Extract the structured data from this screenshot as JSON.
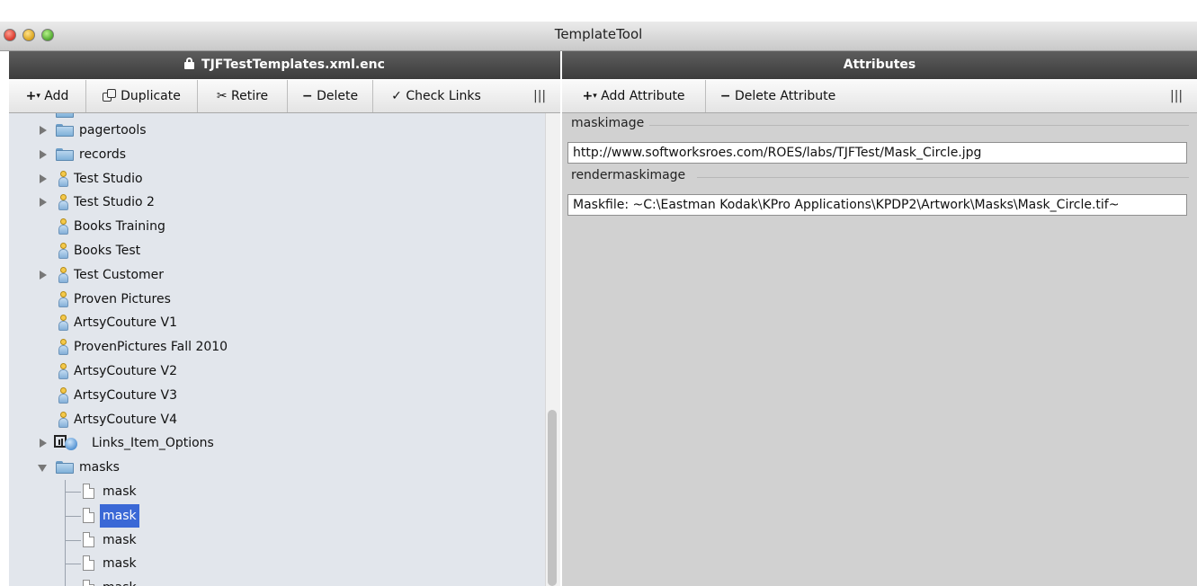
{
  "window": {
    "title": "TemplateTool"
  },
  "left_panel": {
    "header": "TJFTestTemplates.xml.enc",
    "toolbar": {
      "add": "Add",
      "duplicate": "Duplicate",
      "retire": "Retire",
      "delete": "Delete",
      "check_links": "Check Links"
    },
    "tree": [
      {
        "label": "pagertools",
        "icon": "folder-icon",
        "expander": "collapsed"
      },
      {
        "label": "records",
        "icon": "folder-icon",
        "expander": "collapsed"
      },
      {
        "label": "Test Studio",
        "icon": "user-icon",
        "expander": "collapsed"
      },
      {
        "label": "Test Studio 2",
        "icon": "user-icon",
        "expander": "collapsed"
      },
      {
        "label": "Books Training",
        "icon": "user-icon",
        "expander": "none"
      },
      {
        "label": "Books Test",
        "icon": "user-icon",
        "expander": "none"
      },
      {
        "label": "Test Customer",
        "icon": "user-icon",
        "expander": "collapsed"
      },
      {
        "label": "Proven Pictures",
        "icon": "user-icon",
        "expander": "none"
      },
      {
        "label": "ArtsyCouture V1",
        "icon": "user-icon",
        "expander": "none"
      },
      {
        "label": "ProvenPictures Fall 2010",
        "icon": "user-icon",
        "expander": "none"
      },
      {
        "label": "ArtsyCouture V2",
        "icon": "user-icon",
        "expander": "none"
      },
      {
        "label": "ArtsyCouture V3",
        "icon": "user-icon",
        "expander": "none"
      },
      {
        "label": "ArtsyCouture V4",
        "icon": "user-icon",
        "expander": "none"
      },
      {
        "label": "Links_Item_Options",
        "icon": "links-icon",
        "expander": "collapsed"
      },
      {
        "label": "masks",
        "icon": "folder-icon",
        "expander": "expanded"
      },
      {
        "label": "mask",
        "icon": "document-icon",
        "expander": "none"
      },
      {
        "label": "mask",
        "icon": "document-icon",
        "expander": "none",
        "selected": true
      },
      {
        "label": "mask",
        "icon": "document-icon",
        "expander": "none"
      },
      {
        "label": "mask",
        "icon": "document-icon",
        "expander": "none"
      },
      {
        "label": "mask",
        "icon": "document-icon",
        "expander": "none"
      }
    ]
  },
  "right_panel": {
    "header": "Attributes",
    "toolbar": {
      "add_attribute": "Add Attribute",
      "delete_attribute": "Delete Attribute"
    },
    "attributes": [
      {
        "name": "maskimage",
        "value": "http://www.softworksroes.com/ROES/labs/TJFTest/Mask_Circle.jpg"
      },
      {
        "name": "rendermaskimage",
        "value": "Maskfile: ~C:\\Eastman Kodak\\KPro Applications\\KPDP2\\Artwork\\Masks\\Mask_Circle.tif~"
      }
    ]
  },
  "colors": {
    "selection": "#3a68d6",
    "header_dark": "#444444",
    "tree_bg": "#e2e6ec",
    "pane_bg": "#d1d1d1"
  }
}
